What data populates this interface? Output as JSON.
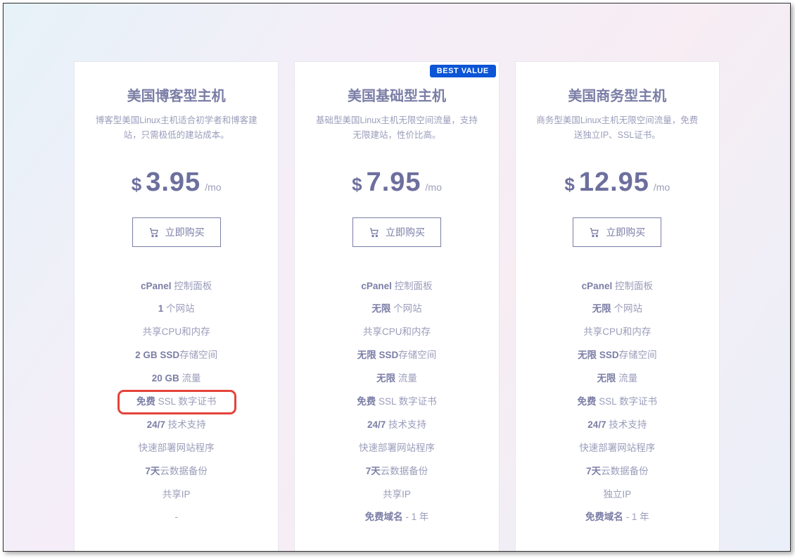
{
  "badge_text": "BEST VALUE",
  "buy_label": "立即购买",
  "currency": "$",
  "period": "/mo",
  "plans": [
    {
      "title": "美国博客型主机",
      "desc": "博客型美国Linux主机适合初学者和博客建站，只需极低的建站成本。",
      "price": "3.95",
      "badge": false,
      "features": [
        {
          "bold": "cPanel",
          "rest": " 控制面板"
        },
        {
          "bold": "1",
          "rest": " 个网站"
        },
        {
          "bold": "",
          "rest": "共享CPU和内存"
        },
        {
          "bold": "2 GB SSD",
          "rest": "存储空间"
        },
        {
          "bold": "20 GB",
          "rest": " 流量"
        },
        {
          "bold": "免费",
          "rest": " SSL 数字证书"
        },
        {
          "bold": "24/7",
          "rest": " 技术支持"
        },
        {
          "bold": "",
          "rest": "快速部署网站程序"
        },
        {
          "bold": "7天",
          "rest": "云数据备份"
        },
        {
          "bold": "",
          "rest": "共享IP"
        },
        {
          "bold": "",
          "rest": "-"
        }
      ]
    },
    {
      "title": "美国基础型主机",
      "desc": "基础型美国Linux主机无限空间流量，支持无限建站，性价比高。",
      "price": "7.95",
      "badge": true,
      "features": [
        {
          "bold": "cPanel",
          "rest": " 控制面板"
        },
        {
          "bold": "无限",
          "rest": " 个网站"
        },
        {
          "bold": "",
          "rest": "共享CPU和内存"
        },
        {
          "bold": "无限 SSD",
          "rest": "存储空间"
        },
        {
          "bold": "无限",
          "rest": " 流量"
        },
        {
          "bold": "免费",
          "rest": " SSL 数字证书"
        },
        {
          "bold": "24/7",
          "rest": " 技术支持"
        },
        {
          "bold": "",
          "rest": "快速部署网站程序"
        },
        {
          "bold": "7天",
          "rest": "云数据备份"
        },
        {
          "bold": "",
          "rest": "共享IP"
        },
        {
          "bold": "免费域名",
          "rest": " - 1 年"
        }
      ]
    },
    {
      "title": "美国商务型主机",
      "desc": "商务型美国Linux主机无限空间流量，免费送独立IP、SSL证书。",
      "price": "12.95",
      "badge": false,
      "features": [
        {
          "bold": "cPanel",
          "rest": " 控制面板"
        },
        {
          "bold": "无限",
          "rest": " 个网站"
        },
        {
          "bold": "",
          "rest": "共享CPU和内存"
        },
        {
          "bold": "无限 SSD",
          "rest": "存储空间"
        },
        {
          "bold": "无限",
          "rest": " 流量"
        },
        {
          "bold": "免费",
          "rest": " SSL 数字证书"
        },
        {
          "bold": "24/7",
          "rest": " 技术支持"
        },
        {
          "bold": "",
          "rest": "快速部署网站程序"
        },
        {
          "bold": "7天",
          "rest": "云数据备份"
        },
        {
          "bold": "",
          "rest": "独立IP"
        },
        {
          "bold": "免费域名",
          "rest": " - 1 年"
        }
      ]
    }
  ],
  "highlight": {
    "plan_index": 0,
    "feature_index": 5
  }
}
